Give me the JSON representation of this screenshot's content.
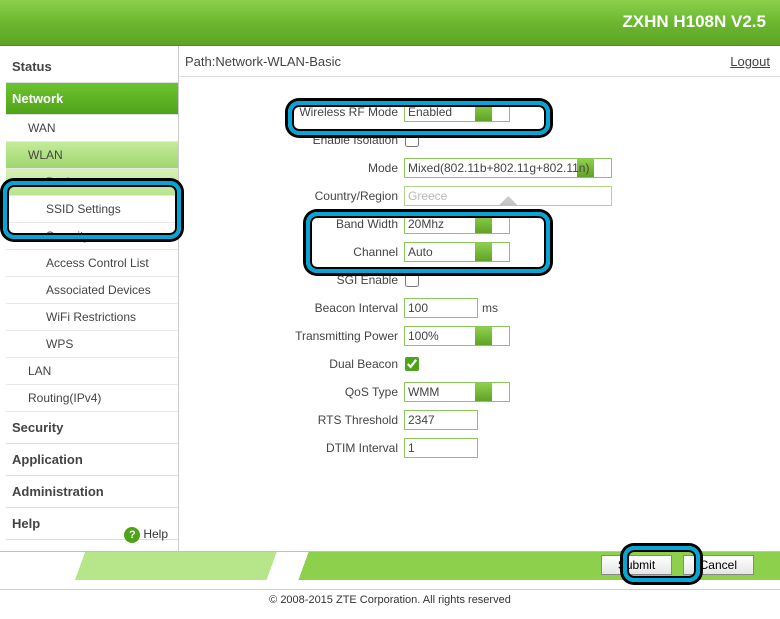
{
  "header": {
    "title": "ZXHN H108N V2.5"
  },
  "path": {
    "label": "Path:Network-WLAN-Basic",
    "logout": "Logout"
  },
  "sidebar": {
    "items": [
      {
        "label": "Status"
      },
      {
        "label": "Network"
      },
      {
        "label": "Security"
      },
      {
        "label": "Application"
      },
      {
        "label": "Administration"
      },
      {
        "label": "Help"
      }
    ],
    "network_children": [
      {
        "label": "WAN"
      },
      {
        "label": "WLAN"
      },
      {
        "label": "LAN"
      },
      {
        "label": "Routing(IPv4)"
      }
    ],
    "wlan_children": [
      {
        "label": "Basic"
      },
      {
        "label": "SSID Settings"
      },
      {
        "label": "Security"
      },
      {
        "label": "Access Control List"
      },
      {
        "label": "Associated Devices"
      },
      {
        "label": "WiFi Restrictions"
      },
      {
        "label": "WPS"
      }
    ],
    "help": "Help"
  },
  "form": {
    "rf_mode": {
      "label": "Wireless RF Mode",
      "value": "Enabled"
    },
    "isolation": {
      "label": "Enable Isolation",
      "checked": false
    },
    "mode": {
      "label": "Mode",
      "value": "Mixed(802.11b+802.11g+802.11n)"
    },
    "country": {
      "label": "Country/Region",
      "value": "Greece"
    },
    "bandwidth": {
      "label": "Band Width",
      "value": "20Mhz"
    },
    "channel": {
      "label": "Channel",
      "value": "Auto"
    },
    "sgi": {
      "label": "SGI Enable",
      "checked": false
    },
    "beacon_int": {
      "label": "Beacon Interval",
      "value": "100",
      "unit": "ms"
    },
    "tx_power": {
      "label": "Transmitting Power",
      "value": "100%"
    },
    "dual_beacon": {
      "label": "Dual Beacon",
      "checked": true
    },
    "qos": {
      "label": "QoS Type",
      "value": "WMM"
    },
    "rts": {
      "label": "RTS Threshold",
      "value": "2347"
    },
    "dtim": {
      "label": "DTIM Interval",
      "value": "1"
    }
  },
  "buttons": {
    "submit": "Submit",
    "cancel": "Cancel"
  },
  "copyright": "© 2008-2015 ZTE Corporation. All rights reserved"
}
